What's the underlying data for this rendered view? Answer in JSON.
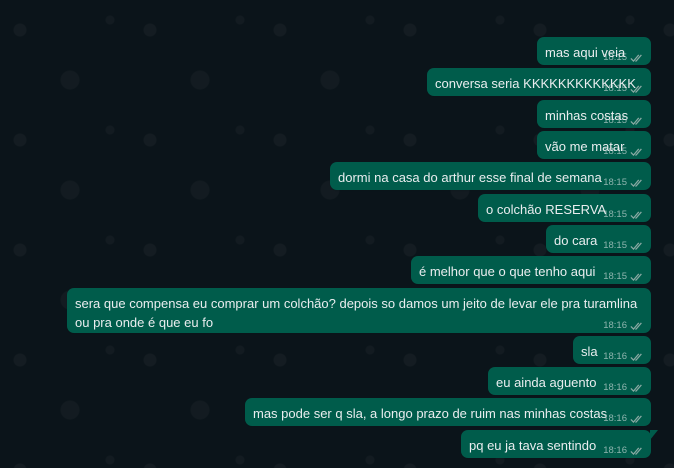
{
  "colors": {
    "background": "#0b141a",
    "bubble_outgoing": "#005c4b",
    "text": "#e9edef",
    "meta": "#8aa9a3"
  },
  "messages": [
    {
      "text": "mas aqui veia",
      "time": "18:15",
      "status_icon": "double-check-icon"
    },
    {
      "text": "conversa seria KKKKKKKKKKKKK",
      "time": "18:15",
      "status_icon": "double-check-icon"
    },
    {
      "text": "minhas costas",
      "time": "18:15",
      "status_icon": "double-check-icon"
    },
    {
      "text": "vão me matar",
      "time": "18:15",
      "status_icon": "double-check-icon"
    },
    {
      "text": "dormi na casa do arthur esse final de semana",
      "time": "18:15",
      "status_icon": "double-check-icon"
    },
    {
      "text": "o colchão RESERVA",
      "time": "18:15",
      "status_icon": "double-check-icon"
    },
    {
      "text": "do cara",
      "time": "18:15",
      "status_icon": "double-check-icon"
    },
    {
      "text": "é melhor que o que tenho aqui",
      "time": "18:15",
      "status_icon": "double-check-icon"
    },
    {
      "text": "sera que compensa eu comprar um colchão? depois so damos um jeito de levar ele pra turamlina ou pra onde é que eu fo",
      "time": "18:16",
      "status_icon": "double-check-icon"
    },
    {
      "text": "sla",
      "time": "18:16",
      "status_icon": "double-check-icon"
    },
    {
      "text": "eu ainda aguento",
      "time": "18:16",
      "status_icon": "double-check-icon"
    },
    {
      "text": "mas pode ser q sla, a longo prazo de ruim nas minhas costas",
      "time": "18:16",
      "status_icon": "double-check-icon"
    },
    {
      "text": "pq eu ja tava sentindo",
      "time": "18:16",
      "status_icon": "double-check-icon"
    }
  ]
}
